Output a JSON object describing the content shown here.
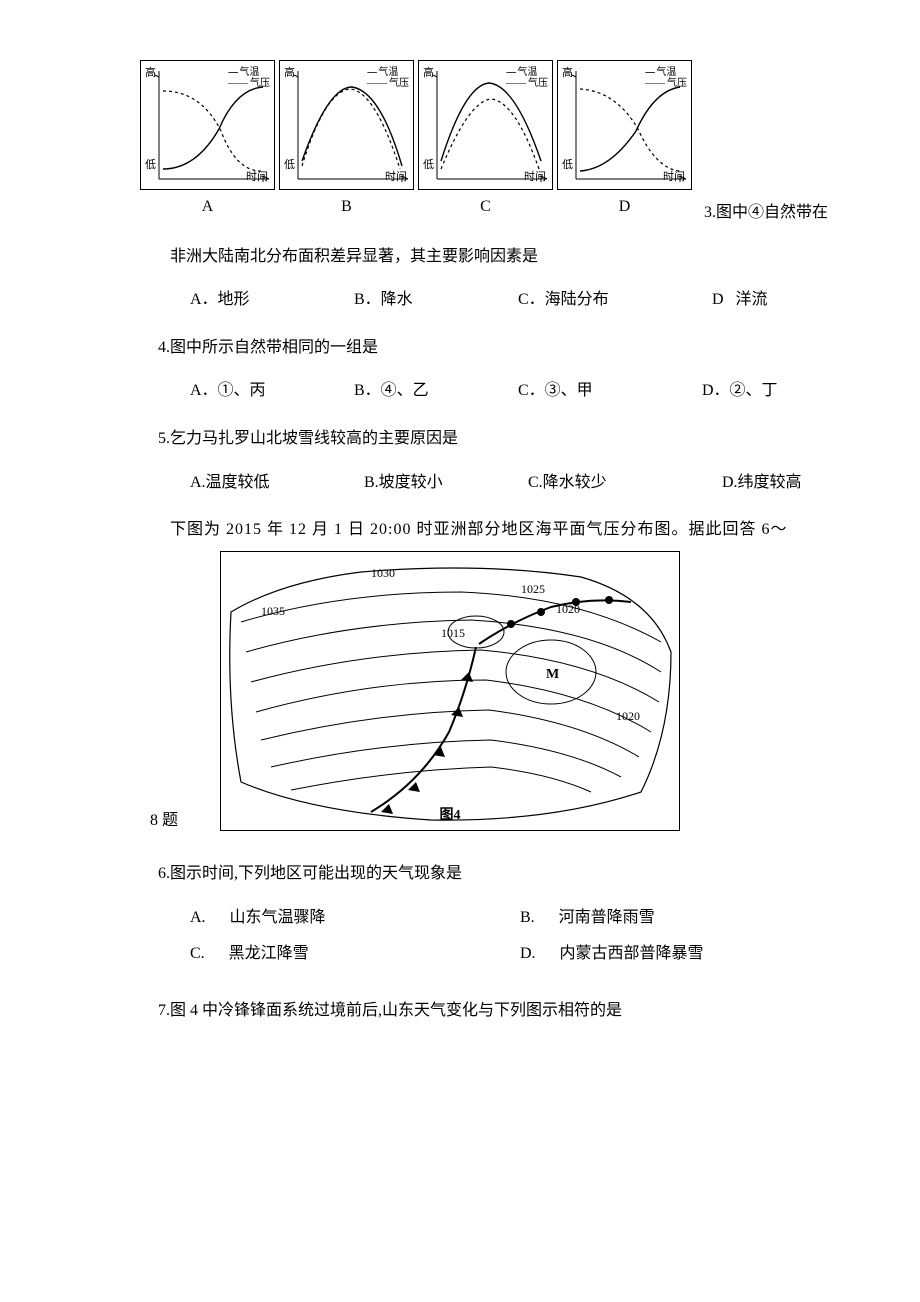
{
  "panels": {
    "axis_high": "高",
    "axis_low": "低",
    "axis_time": "时间",
    "legend_temp": "气温",
    "legend_pres": "气压",
    "labels": [
      "A",
      "B",
      "C",
      "D"
    ]
  },
  "q3": {
    "inline": "3.图中④自然带在",
    "cont": "非洲大陆南北分布面积差异显著，其主要影响因素是",
    "a": "A．地形",
    "b": "B．降水",
    "c": "C．海陆分布",
    "d": "D   洋流"
  },
  "q4": {
    "stem": "4.图中所示自然带相同的一组是",
    "a": "A．①、丙",
    "b": "B．④、乙",
    "c": "C．③、甲",
    "d": "D．②、丁"
  },
  "q5": {
    "stem": "5.乞力马扎罗山北坡雪线较高的主要原因是",
    "a": "A.温度较低",
    "b": "B.坡度较小",
    "c": "C.降水较少",
    "d": "D.纬度较高"
  },
  "stem68": "下图为  2015  年  12  月  1  日  20:00  时亚洲部分地区海平面气压分布图。据此回答  6～",
  "stem68_cont": "8   题",
  "map": {
    "vals": [
      "1030",
      "1035",
      "1025",
      "1020",
      "1015",
      "1020"
    ],
    "m": "M",
    "caption": "图4"
  },
  "q6": {
    "stem": "6.图示时间,下列地区可能出现的天气现象是",
    "a": "A.      山东气温骤降",
    "b": "B.      河南普降雨雪",
    "c": "C.      黑龙江降雪",
    "d": "D.      内蒙古西部普降暴雪"
  },
  "q7": {
    "stem": "7.图   4   中冷锋锋面系统过境前后,山东天气变化与下列图示相符的是"
  }
}
